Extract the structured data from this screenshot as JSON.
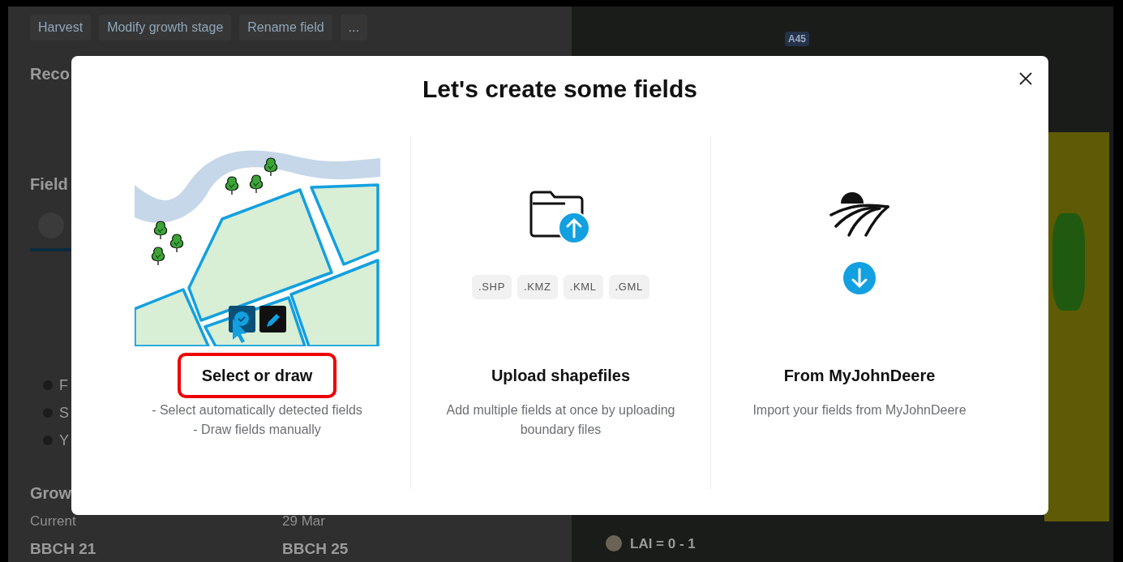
{
  "toolbar": {
    "buttons": [
      "Harvest",
      "Modify growth stage",
      "Rename field",
      "..."
    ]
  },
  "panel": {
    "heading_1": "Reco",
    "heading_2": "Field",
    "list": [
      "F",
      "S",
      "Y"
    ],
    "heading_3": "Grow",
    "growth": [
      {
        "label": "Current",
        "value": "BBCH 21"
      },
      {
        "label": "29 Mar",
        "value": "BBCH 25"
      }
    ]
  },
  "map": {
    "road_badge": "A45",
    "legend": [
      {
        "label": "LAI = 0 - 1",
        "color": "#6b6456"
      }
    ]
  },
  "dialog": {
    "title": "Let's create some fields",
    "options": [
      {
        "kind": "draw",
        "title": "Select or draw",
        "highlighted": true,
        "description": [
          "- Select automatically detected fields",
          "- Draw fields manually"
        ]
      },
      {
        "kind": "upload",
        "title": "Upload shapefiles",
        "highlighted": false,
        "formats": [
          ".SHP",
          ".KMZ",
          ".KML",
          ".GML"
        ],
        "description": [
          "Add multiple fields at once by uploading boundary files"
        ]
      },
      {
        "kind": "import",
        "title": "From MyJohnDeere",
        "highlighted": false,
        "description": [
          "Import your fields from MyJohnDeere"
        ]
      }
    ]
  }
}
